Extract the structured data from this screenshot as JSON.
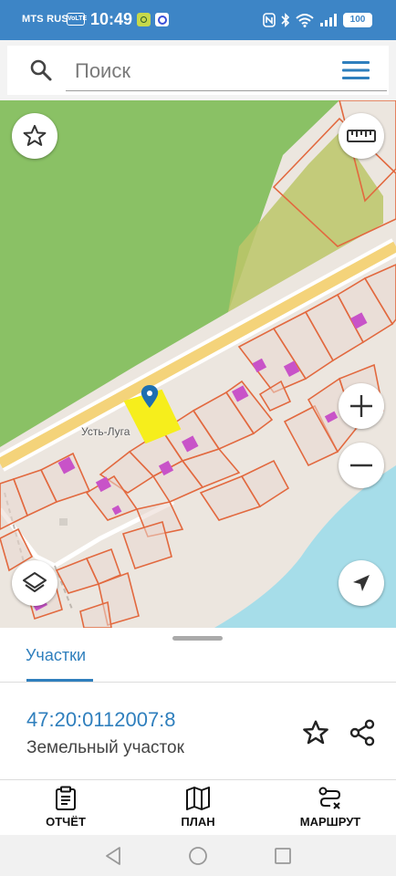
{
  "status_bar": {
    "carrier": "MTS RUS",
    "volte": "VoLTE",
    "time": "10:49",
    "battery": "100"
  },
  "search": {
    "placeholder": "Поиск",
    "icons": [
      "search-icon",
      "menu-icon"
    ]
  },
  "map": {
    "place_label": "Усть-Луга",
    "controls": [
      "star-icon",
      "ruler-icon",
      "plus-icon",
      "minus-icon",
      "layers-icon",
      "navigation-arrow-icon"
    ],
    "colors": {
      "forest": "#8ac165",
      "water": "#a6dde9",
      "land": "#ece6df",
      "road": "#f4d37a",
      "parcel_border": "#e2693f",
      "selected_parcel": "#f6ee1c",
      "building": "#c853c8",
      "marker": "#1d6fb1"
    }
  },
  "sheet": {
    "tab_label": "Участки",
    "parcel_number": "47:20:0112007:8",
    "parcel_type": "Земельный участок",
    "icons": [
      "star-outline-icon",
      "share-icon"
    ]
  },
  "actions": {
    "report": "ОТЧЁТ",
    "plan": "ПЛАН",
    "route": "МАРШРУТ"
  },
  "colors": {
    "accent": "#2f7fbd",
    "status_bar": "#3d85c6"
  }
}
